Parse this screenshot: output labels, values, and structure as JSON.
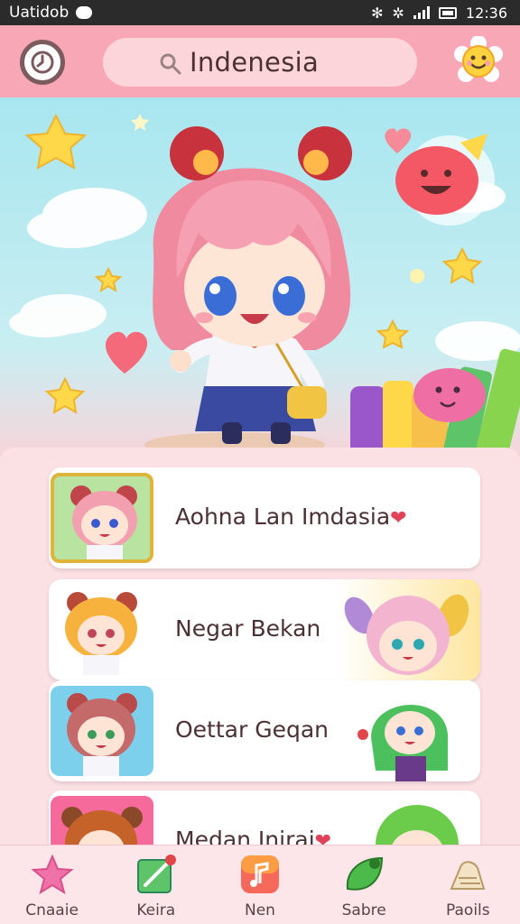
{
  "status_bar": {
    "carrier": "Uatidob",
    "time": "12:36"
  },
  "header": {
    "search_text": "Indenesia"
  },
  "list": {
    "items": [
      {
        "label": "Aohna Lan Imdasia",
        "heart": "❤"
      },
      {
        "label": "Negar Bekan"
      },
      {
        "label": "Oettar Geqan"
      },
      {
        "label": "Medan Inirai",
        "heart": "❤"
      }
    ]
  },
  "bottom_nav": {
    "items": [
      {
        "label": "Cnaaie",
        "icon": "star-icon"
      },
      {
        "label": "Keira",
        "icon": "pencil-icon"
      },
      {
        "label": "Nen",
        "icon": "music-note-icon"
      },
      {
        "label": "Sabre",
        "icon": "leaf-icon"
      },
      {
        "label": "Paoils",
        "icon": "shell-icon"
      }
    ]
  },
  "colors": {
    "header": "#f7a7b6",
    "panel": "#fbe0e4",
    "text": "#4b3134",
    "accent_heart": "#e04358"
  }
}
